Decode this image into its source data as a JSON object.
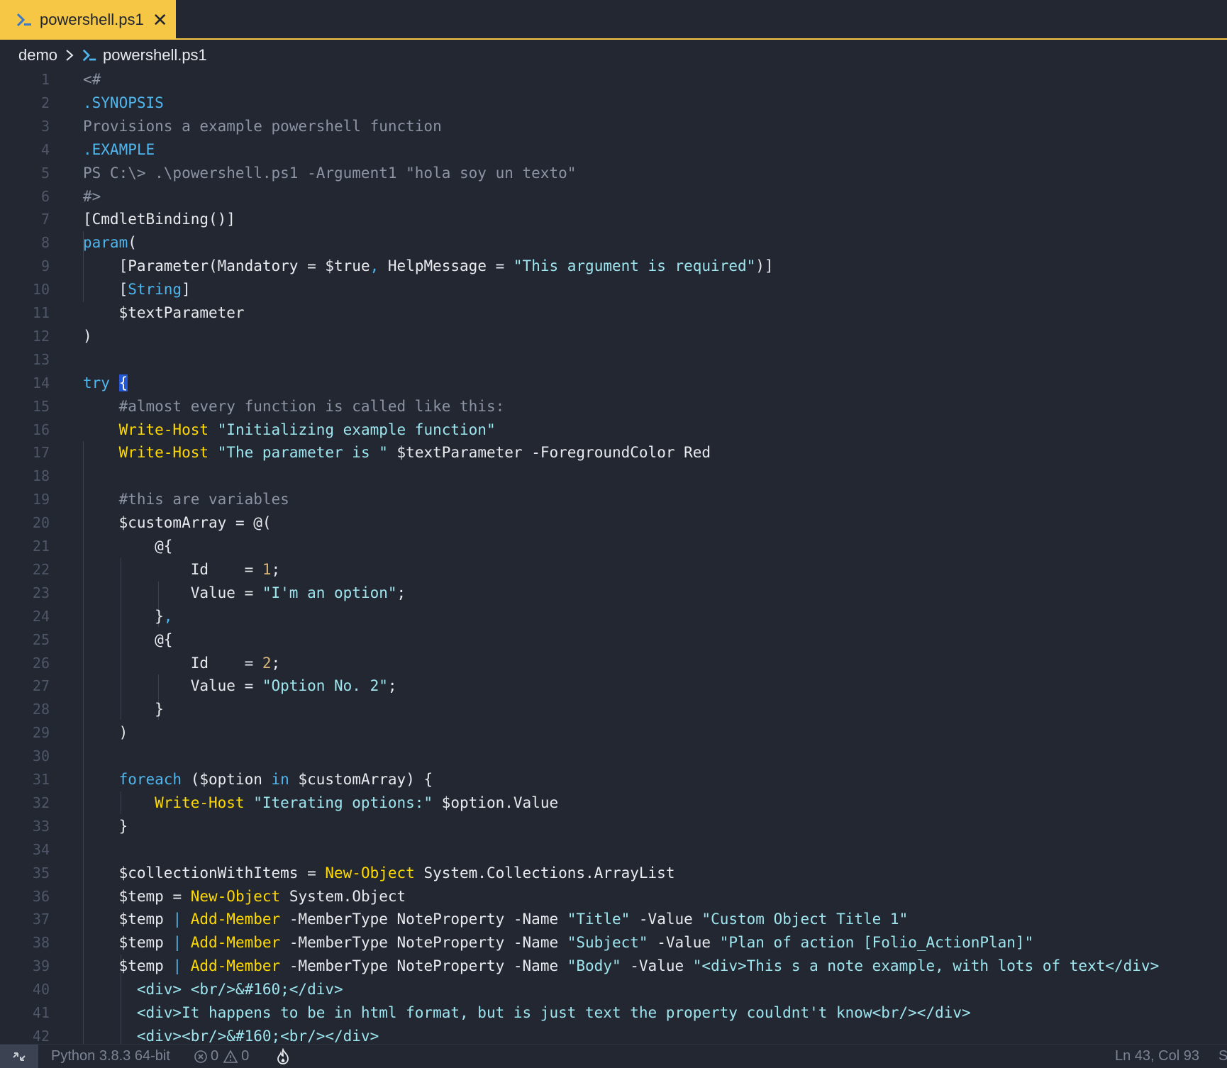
{
  "tab": {
    "label": "powershell.ps1",
    "close": "✕"
  },
  "breadcrumb": {
    "folder": "demo",
    "file": "powershell.ps1"
  },
  "code_lines": [
    {
      "n": "1",
      "t": [
        [
          "cm",
          "<#"
        ]
      ]
    },
    {
      "n": "2",
      "t": [
        [
          "kw",
          ".SYNOPSIS"
        ]
      ]
    },
    {
      "n": "3",
      "t": [
        [
          "cm",
          "Provisions a example powershell function"
        ]
      ]
    },
    {
      "n": "4",
      "t": [
        [
          "kw",
          ".EXAMPLE"
        ]
      ]
    },
    {
      "n": "5",
      "t": [
        [
          "cm",
          "PS C:\\> .\\powershell.ps1 -Argument1 \"hola soy un texto\""
        ]
      ]
    },
    {
      "n": "6",
      "t": [
        [
          "cm",
          "#>"
        ]
      ]
    },
    {
      "n": "7",
      "t": [
        [
          "p",
          "[CmdletBinding()]"
        ]
      ]
    },
    {
      "n": "8",
      "t": [
        [
          "kw",
          "param"
        ],
        [
          "p",
          "("
        ]
      ]
    },
    {
      "n": "9",
      "t": [
        [
          "p",
          "    [Parameter(Mandatory = "
        ],
        [
          "var",
          "$true"
        ],
        [
          "kw",
          ", "
        ],
        [
          "p",
          "HelpMessage = "
        ],
        [
          "str",
          "\"This argument is required\""
        ],
        [
          "p",
          ")]"
        ]
      ]
    },
    {
      "n": "10",
      "t": [
        [
          "p",
          "    ["
        ],
        [
          "kw",
          "String"
        ],
        [
          "p",
          "]"
        ]
      ]
    },
    {
      "n": "11",
      "t": [
        [
          "var",
          "    $textParameter"
        ]
      ]
    },
    {
      "n": "12",
      "t": [
        [
          "p",
          ")"
        ]
      ]
    },
    {
      "n": "13",
      "t": []
    },
    {
      "n": "14",
      "t": [
        [
          "kw",
          "try "
        ],
        [
          "cur",
          "{"
        ]
      ]
    },
    {
      "n": "15",
      "t": [
        [
          "cm",
          "    #almost every function is called like this:"
        ]
      ]
    },
    {
      "n": "16",
      "t": [
        [
          "fn",
          "    Write-Host "
        ],
        [
          "str",
          "\"Initializing example function\""
        ]
      ]
    },
    {
      "n": "17",
      "t": [
        [
          "fn",
          "    Write-Host "
        ],
        [
          "str",
          "\"The parameter is \" "
        ],
        [
          "var",
          "$textParameter "
        ],
        [
          "tx",
          "-ForegroundColor Red"
        ]
      ]
    },
    {
      "n": "18",
      "t": []
    },
    {
      "n": "19",
      "t": [
        [
          "cm",
          "    #this are variables"
        ]
      ]
    },
    {
      "n": "20",
      "t": [
        [
          "var",
          "    $customArray "
        ],
        [
          "p",
          "= @("
        ]
      ]
    },
    {
      "n": "21",
      "t": [
        [
          "p",
          "        @{"
        ]
      ]
    },
    {
      "n": "22",
      "t": [
        [
          "p",
          "            Id    = "
        ],
        [
          "num",
          "1"
        ],
        [
          "p",
          ";"
        ]
      ]
    },
    {
      "n": "23",
      "t": [
        [
          "p",
          "            Value = "
        ],
        [
          "str",
          "\"I'm an option\""
        ],
        [
          "p",
          ";"
        ]
      ]
    },
    {
      "n": "24",
      "t": [
        [
          "p",
          "        }"
        ],
        [
          "kw",
          ","
        ]
      ]
    },
    {
      "n": "25",
      "t": [
        [
          "p",
          "        @{"
        ]
      ]
    },
    {
      "n": "26",
      "t": [
        [
          "p",
          "            Id    = "
        ],
        [
          "num",
          "2"
        ],
        [
          "p",
          ";"
        ]
      ]
    },
    {
      "n": "27",
      "t": [
        [
          "p",
          "            Value = "
        ],
        [
          "str",
          "\"Option No. 2\""
        ],
        [
          "p",
          ";"
        ]
      ]
    },
    {
      "n": "28",
      "t": [
        [
          "p",
          "        }"
        ]
      ]
    },
    {
      "n": "29",
      "t": [
        [
          "p",
          "    )"
        ]
      ]
    },
    {
      "n": "30",
      "t": []
    },
    {
      "n": "31",
      "t": [
        [
          "kw",
          "    foreach "
        ],
        [
          "p",
          "("
        ],
        [
          "var",
          "$option "
        ],
        [
          "kw",
          "in "
        ],
        [
          "var",
          "$customArray"
        ],
        [
          "p",
          ") {"
        ]
      ]
    },
    {
      "n": "32",
      "t": [
        [
          "fn",
          "        Write-Host "
        ],
        [
          "str",
          "\"Iterating options:\" "
        ],
        [
          "var",
          "$option"
        ],
        [
          "p",
          ".Value"
        ]
      ]
    },
    {
      "n": "33",
      "t": [
        [
          "p",
          "    }"
        ]
      ]
    },
    {
      "n": "34",
      "t": []
    },
    {
      "n": "35",
      "t": [
        [
          "var",
          "    $collectionWithItems "
        ],
        [
          "p",
          "= "
        ],
        [
          "fn",
          "New-Object "
        ],
        [
          "tx",
          "System.Collections.ArrayList"
        ]
      ]
    },
    {
      "n": "36",
      "t": [
        [
          "var",
          "    $temp "
        ],
        [
          "p",
          "= "
        ],
        [
          "fn",
          "New-Object "
        ],
        [
          "tx",
          "System.Object"
        ]
      ]
    },
    {
      "n": "37",
      "t": [
        [
          "var",
          "    $temp "
        ],
        [
          "kw",
          "| "
        ],
        [
          "fn",
          "Add-Member "
        ],
        [
          "tx",
          "-MemberType NoteProperty -Name "
        ],
        [
          "str",
          "\"Title\" "
        ],
        [
          "tx",
          "-Value "
        ],
        [
          "str",
          "\"Custom Object Title 1\""
        ]
      ]
    },
    {
      "n": "38",
      "t": [
        [
          "var",
          "    $temp "
        ],
        [
          "kw",
          "| "
        ],
        [
          "fn",
          "Add-Member "
        ],
        [
          "tx",
          "-MemberType NoteProperty -Name "
        ],
        [
          "str",
          "\"Subject\" "
        ],
        [
          "tx",
          "-Value "
        ],
        [
          "str",
          "\"Plan of action [Folio_ActionPlan]\""
        ]
      ]
    },
    {
      "n": "39",
      "t": [
        [
          "var",
          "    $temp "
        ],
        [
          "kw",
          "| "
        ],
        [
          "fn",
          "Add-Member "
        ],
        [
          "tx",
          "-MemberType NoteProperty -Name "
        ],
        [
          "str",
          "\"Body\" "
        ],
        [
          "tx",
          "-Value "
        ],
        [
          "str",
          "\"<div>This s a note example, with lots of text</div>"
        ]
      ]
    },
    {
      "n": "40",
      "t": [
        [
          "str",
          "      <div> <br/>&#160;</div>"
        ]
      ]
    },
    {
      "n": "41",
      "t": [
        [
          "str",
          "      <div>It happens to be in html format, but is just text the property couldnt't know<br/></div>"
        ]
      ]
    },
    {
      "n": "42",
      "t": [
        [
          "str",
          "      <div><br/>&#160;<br/></div>"
        ]
      ]
    }
  ],
  "status": {
    "interpreter": "Python 3.8.3 64-bit",
    "errors": "0",
    "warnings": "0",
    "position": "Ln 43, Col 93",
    "edge": "S"
  },
  "colors": {
    "background": "#222732",
    "tab_accent": "#f5c744",
    "keyword": "#4fb7ee",
    "function": "#ffd900",
    "string": "#9ee6ef",
    "comment": "#8c93a3",
    "number": "#d9b77a"
  },
  "icons": [
    "powershell-icon",
    "close-icon",
    "chevron-right-icon",
    "remote-icon",
    "error-icon",
    "warning-icon",
    "flame-icon"
  ]
}
